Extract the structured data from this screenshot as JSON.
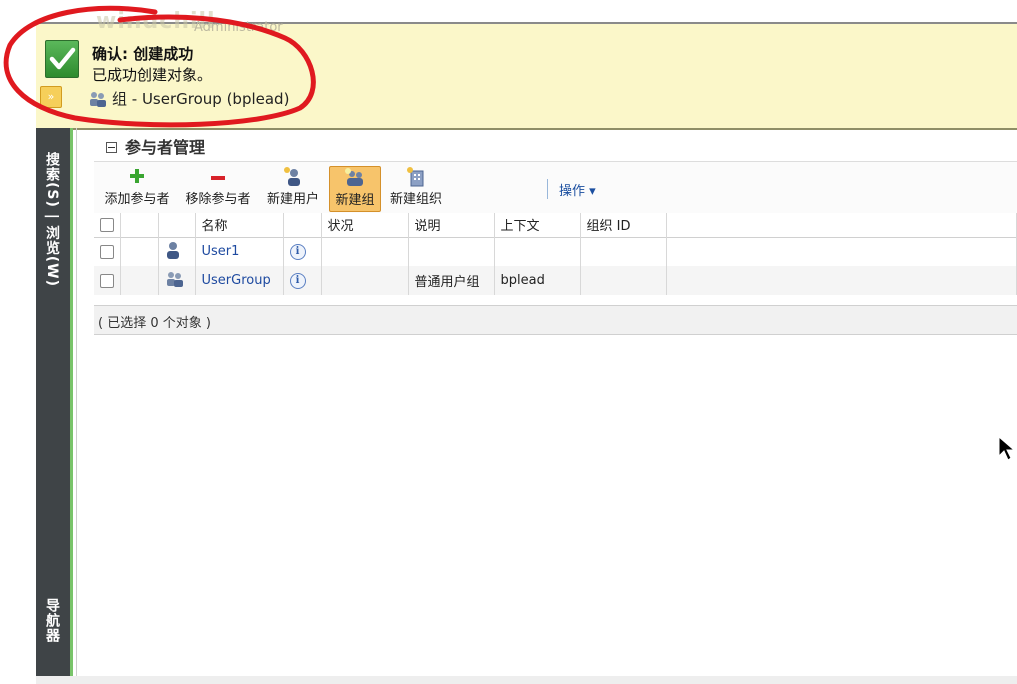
{
  "header": {
    "logo_text": "windchill",
    "user": "Administrator",
    "notification_title": "确认: 创建成功",
    "notification_message": "已成功创建对象。",
    "breadcrumb": "组 - UserGroup (bplead)"
  },
  "left_nav": {
    "search_browse": "搜索(S) | 浏览(W)",
    "navigator": "导航器"
  },
  "panel": {
    "title": "参与者管理"
  },
  "toolbar": {
    "add_participant": "添加参与者",
    "remove_participant": "移除参与者",
    "new_user": "新建用户",
    "new_group": "新建组",
    "new_org": "新建组织",
    "actions": "操作 ▾"
  },
  "table": {
    "columns": [
      "名称",
      "状况",
      "说明",
      "上下文",
      "组织 ID"
    ],
    "rows": [
      {
        "name": "User1",
        "status": "",
        "description": "",
        "context": "",
        "org_id": ""
      },
      {
        "name": "UserGroup",
        "status": "",
        "description": "普通用户组",
        "context": "bplead",
        "org_id": ""
      }
    ],
    "selection_status": "( 已选择 0 个对象 )"
  },
  "colors": {
    "header_bg": "#fbf7c9",
    "nav_bg": "#3f4447",
    "link": "#1e4aa0",
    "active_button": "#f7c46b",
    "annotation_red": "#e0191f"
  }
}
